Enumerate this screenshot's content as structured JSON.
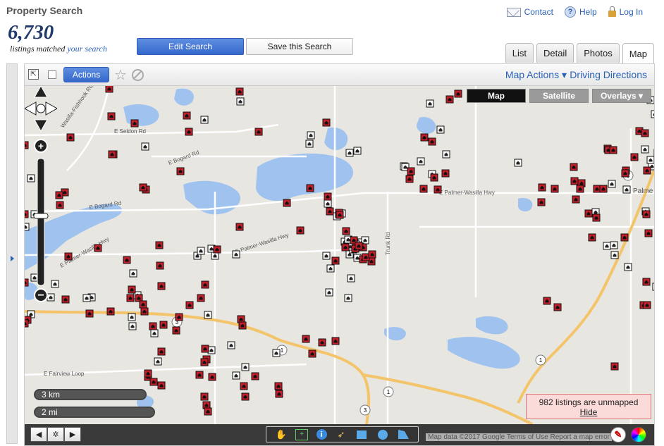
{
  "header": {
    "title": "Property Search",
    "count": "6,730",
    "count_sub_a": "listings matched ",
    "count_sub_b": "your search",
    "edit_search": "Edit Search",
    "save_search": "Save this Search"
  },
  "top_links": {
    "contact": "Contact",
    "help": "Help",
    "login": "Log In"
  },
  "tabs": [
    {
      "label": "List"
    },
    {
      "label": "Detail"
    },
    {
      "label": "Photos"
    },
    {
      "label": "Map",
      "active": true
    }
  ],
  "toolbar": {
    "actions": "Actions",
    "map_actions": "Map Actions",
    "driving_directions": "Driving Directions"
  },
  "map_type": {
    "map": "Map",
    "satellite": "Satellite",
    "overlays": "Overlays ▾"
  },
  "road_labels": {
    "wasilla_fishhook": "Wasilla-Fishhook Rd",
    "seldon": "E Seldon Rd",
    "bogard_top": "E Bogard Rd",
    "bogard_left": "E Bogard Rd",
    "palmer_wasilla_hwy": "E Palmer-Wasilla Hwy",
    "palmer_wasilla_hwy_mid": "E Palmer-Wasilla Hwy",
    "parks_hwy_left": "E Palmer-Wasilla Hwy",
    "fairview": "E Fairview Loop",
    "trunk": "Trunk Rd",
    "palmer": "Palme"
  },
  "route_shields": [
    "3",
    "3",
    "1",
    "1",
    "1",
    "3"
  ],
  "scale": {
    "km": "3 km",
    "mi": "2 mi"
  },
  "unmapped": {
    "text": "982 listings are unmapped",
    "hide": "Hide"
  },
  "footer": {
    "credit": "Map data ©2017 Google   Terms of Use   Report a map error"
  },
  "colors": {
    "accent": "#3568cc",
    "pin_red": "#c21f2b",
    "water": "#9fc3ee",
    "road": "#f3c46a"
  }
}
